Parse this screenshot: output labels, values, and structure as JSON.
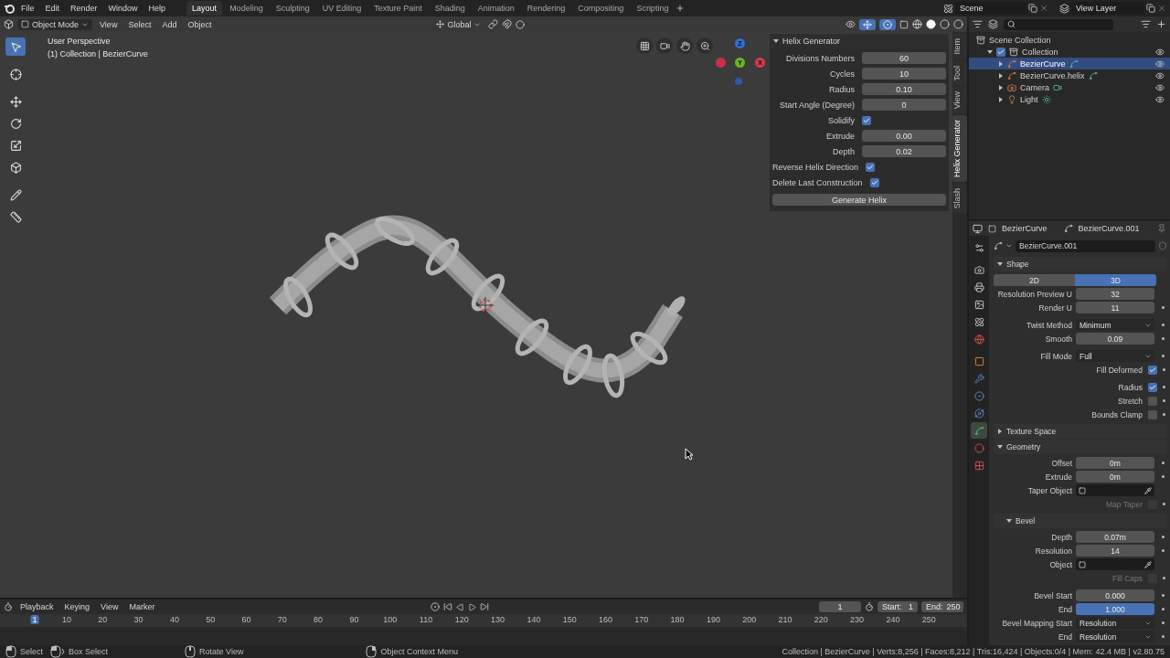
{
  "menus": [
    "File",
    "Edit",
    "Render",
    "Window",
    "Help"
  ],
  "workspaces": [
    {
      "label": "Layout",
      "selected": true
    },
    {
      "label": "Modeling",
      "selected": false
    },
    {
      "label": "Sculpting",
      "selected": false
    },
    {
      "label": "UV Editing",
      "selected": false
    },
    {
      "label": "Texture Paint",
      "selected": false
    },
    {
      "label": "Shading",
      "selected": false
    },
    {
      "label": "Animation",
      "selected": false
    },
    {
      "label": "Rendering",
      "selected": false
    },
    {
      "label": "Compositing",
      "selected": false
    },
    {
      "label": "Scripting",
      "selected": false
    }
  ],
  "scene": "Scene",
  "view_layer": "View Layer",
  "viewport": {
    "mode": "Object Mode",
    "menus": [
      "View",
      "Select",
      "Add",
      "Object"
    ],
    "orientation": "Global",
    "gizmo_toggle": {
      "on": true
    },
    "overlay_toggle": {
      "on": true
    },
    "overlay_text": [
      "User Perspective",
      "(1) Collection | BezierCurve"
    ],
    "tools": [
      {
        "kind": "select",
        "selected": true
      },
      {
        "kind": "cursor",
        "selected": false
      },
      {
        "kind": "move",
        "selected": false
      },
      {
        "kind": "rotate",
        "selected": false
      },
      {
        "kind": "scale",
        "selected": false
      },
      {
        "kind": "transform",
        "selected": false
      },
      {
        "kind": "annotate",
        "selected": false
      },
      {
        "kind": "measure",
        "selected": false
      }
    ],
    "gizmo": [
      {
        "label": "Z",
        "color": "#2f6fd6"
      },
      {
        "label": "Y",
        "color": "#6cb520"
      },
      {
        "label": "X",
        "color": "#d8384c"
      }
    ]
  },
  "helix_panel": {
    "title": "Helix Generator",
    "expanded": true,
    "fields": [
      {
        "kind": "number",
        "label": "Divisions Numbers",
        "value": "60"
      },
      {
        "kind": "number",
        "label": "Cycles",
        "value": "10"
      },
      {
        "kind": "number",
        "label": "Radius",
        "value": "0.10"
      },
      {
        "kind": "number",
        "label": "Start Angle (Degree)",
        "value": "0"
      },
      {
        "kind": "checkbox",
        "label": "Solidify",
        "checked": true
      },
      {
        "kind": "number",
        "label": "Extrude",
        "value": "0.00"
      },
      {
        "kind": "number",
        "label": "Depth",
        "value": "0.02"
      },
      {
        "kind": "checkbox",
        "label": "Reverse Helix Direction",
        "checked": true
      },
      {
        "kind": "checkbox",
        "label": "Delete Last Construction",
        "checked": true
      }
    ],
    "button": "Generate Helix"
  },
  "sidebar_tabs": [
    {
      "label": "Item",
      "selected": false
    },
    {
      "label": "Tool",
      "selected": false
    },
    {
      "label": "View",
      "selected": false
    },
    {
      "label": "Helix Generator",
      "selected": true
    },
    {
      "label": "Slash",
      "selected": false
    }
  ],
  "outliner": {
    "label": "Scene Collection",
    "children": [
      {
        "label": "Collection",
        "kind": "collection",
        "checked": true,
        "expanded": true,
        "selected": false,
        "children": [
          {
            "label": "BezierCurve",
            "kind": "curve",
            "expanded": false,
            "selected": true
          },
          {
            "label": "BezierCurve.helix",
            "kind": "curve",
            "expanded": false,
            "selected": false
          },
          {
            "label": "Camera",
            "kind": "camera",
            "expanded": false,
            "selected": false
          },
          {
            "label": "Light",
            "kind": "light",
            "expanded": false,
            "selected": false
          }
        ]
      }
    ]
  },
  "properties": {
    "object": "BezierCurve",
    "data": "BezierCurve.001",
    "datablock": "BezierCurve.001",
    "tabs": [
      {
        "kind": "tool",
        "selected": false
      },
      {
        "kind": "render",
        "selected": false
      },
      {
        "kind": "output",
        "selected": false
      },
      {
        "kind": "view_layer",
        "selected": false
      },
      {
        "kind": "scene",
        "selected": false
      },
      {
        "kind": "world",
        "selected": false
      },
      {
        "kind": "object",
        "selected": false
      },
      {
        "kind": "modifiers",
        "selected": false
      },
      {
        "kind": "particles",
        "selected": false
      },
      {
        "kind": "physics",
        "selected": false
      },
      {
        "kind": "data",
        "selected": true
      },
      {
        "kind": "material",
        "selected": false
      },
      {
        "kind": "texture",
        "selected": false
      }
    ],
    "sections": [
      {
        "title": "Shape",
        "expanded": true,
        "groups": [
          [
            {
              "kind": "toggle",
              "options": [
                {
                  "label": "2D",
                  "selected": false
                },
                {
                  "label": "3D",
                  "selected": true
                }
              ]
            },
            {
              "kind": "number",
              "label": "Resolution Preview U",
              "value": "32",
              "active": false,
              "keyframe": false
            },
            {
              "kind": "number",
              "label": "Render U",
              "value": "11",
              "active": false,
              "keyframe": true
            }
          ],
          [
            {
              "kind": "dropdown",
              "label": "Twist Method",
              "value": "Minimum",
              "keyframe": true
            },
            {
              "kind": "number",
              "label": "Smooth",
              "value": "0.09",
              "active": false,
              "keyframe": true
            }
          ],
          [
            {
              "kind": "dropdown",
              "label": "Fill Mode",
              "value": "Full",
              "keyframe": true
            },
            {
              "kind": "checkbox",
              "label": "Fill Deformed",
              "checked": true,
              "disabled": false,
              "keyframe": true
            }
          ],
          [
            {
              "kind": "checkbox",
              "label": "Radius",
              "checked": true,
              "disabled": false,
              "keyframe": true
            },
            {
              "kind": "checkbox",
              "label": "Stretch",
              "checked": false,
              "disabled": false,
              "keyframe": true
            },
            {
              "kind": "checkbox",
              "label": "Bounds Clamp",
              "checked": false,
              "disabled": false,
              "keyframe": true
            }
          ]
        ]
      },
      {
        "title": "Texture Space",
        "expanded": false
      },
      {
        "title": "Geometry",
        "expanded": true,
        "groups": [
          [
            {
              "kind": "number",
              "label": "Offset",
              "value": "0m",
              "active": false,
              "keyframe": true
            },
            {
              "kind": "number",
              "label": "Extrude",
              "value": "0m",
              "active": false,
              "keyframe": true
            },
            {
              "kind": "object",
              "label": "Taper Object",
              "keyframe": false
            },
            {
              "kind": "checkbox",
              "label": "Map Taper",
              "checked": false,
              "disabled": true,
              "keyframe": true
            }
          ]
        ],
        "subsections": [
          {
            "title": "Bevel",
            "expanded": true,
            "groups": [
              [
                {
                  "kind": "number",
                  "label": "Depth",
                  "value": "0.07m",
                  "active": false,
                  "keyframe": true
                },
                {
                  "kind": "number",
                  "label": "Resolution",
                  "value": "14",
                  "active": false,
                  "keyframe": true
                },
                {
                  "kind": "object",
                  "label": "Object",
                  "keyframe": false
                },
                {
                  "kind": "checkbox",
                  "label": "Fill Caps",
                  "checked": false,
                  "disabled": true,
                  "keyframe": true
                }
              ],
              [
                {
                  "kind": "number",
                  "label": "Bevel Start",
                  "value": "0.000",
                  "active": false,
                  "keyframe": true
                },
                {
                  "kind": "number",
                  "label": "End",
                  "value": "1.000",
                  "active": true,
                  "keyframe": true
                },
                {
                  "kind": "dropdown",
                  "label": "Bevel Mapping Start",
                  "value": "Resolution",
                  "keyframe": true
                },
                {
                  "kind": "dropdown",
                  "label": "End",
                  "value": "Resolution",
                  "keyframe": true
                }
              ]
            ]
          }
        ]
      }
    ]
  },
  "timeline": {
    "menus": [
      "Playback",
      "Keying",
      "View",
      "Marker"
    ],
    "current_frame": "1",
    "start_label": "Start:",
    "start": "1",
    "end_label": "End:",
    "end": "250",
    "ruler": [
      {
        "label": "1",
        "selected": true
      },
      {
        "label": "10",
        "selected": false
      },
      {
        "label": "20",
        "selected": false
      },
      {
        "label": "30",
        "selected": false
      },
      {
        "label": "40",
        "selected": false
      },
      {
        "label": "50",
        "selected": false
      },
      {
        "label": "60",
        "selected": false
      },
      {
        "label": "70",
        "selected": false
      },
      {
        "label": "80",
        "selected": false
      },
      {
        "label": "90",
        "selected": false
      },
      {
        "label": "100",
        "selected": false
      },
      {
        "label": "110",
        "selected": false
      },
      {
        "label": "120",
        "selected": false
      },
      {
        "label": "130",
        "selected": false
      },
      {
        "label": "140",
        "selected": false
      },
      {
        "label": "150",
        "selected": false
      },
      {
        "label": "160",
        "selected": false
      },
      {
        "label": "170",
        "selected": false
      },
      {
        "label": "180",
        "selected": false
      },
      {
        "label": "190",
        "selected": false
      },
      {
        "label": "200",
        "selected": false
      },
      {
        "label": "210",
        "selected": false
      },
      {
        "label": "220",
        "selected": false
      },
      {
        "label": "230",
        "selected": false
      },
      {
        "label": "240",
        "selected": false
      },
      {
        "label": "250",
        "selected": false
      }
    ]
  },
  "status": {
    "hints": [
      {
        "kind": "mouse_left",
        "label": "Select"
      },
      {
        "kind": "mouse_drag",
        "label": "Box Select"
      },
      {
        "kind": "mouse_middle",
        "label": "Rotate View"
      },
      {
        "kind": "mouse_right",
        "label": "Object Context Menu"
      }
    ],
    "stats": "Collection | BezierCurve | Verts:8,256 | Faces:8,212 | Tris:16,424 | Objects:0/4 | Mem: 42.4 MB | v2.80.75"
  }
}
